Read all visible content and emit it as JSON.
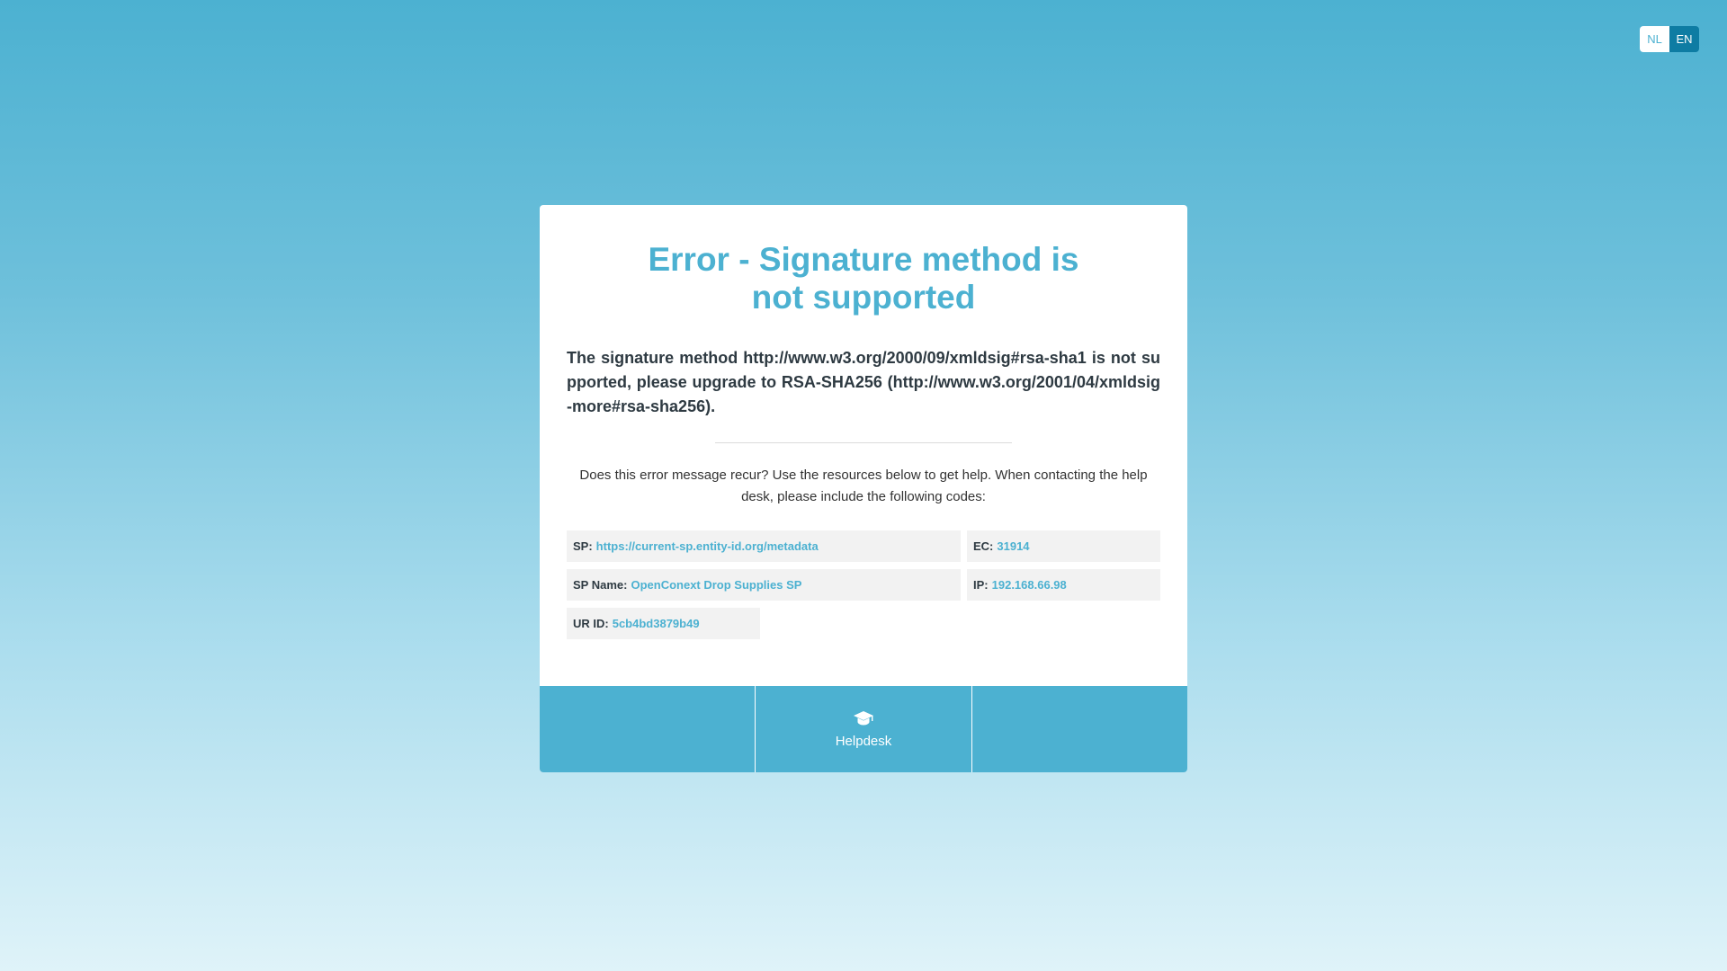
{
  "language_switch": {
    "nl": "NL",
    "en": "EN",
    "active": "EN"
  },
  "error": {
    "title": "Error - Signature method is not supported",
    "message": "The signature method http://www.w3.org/2000/09/xmldsig#rsa-sha1 is not supported, please upgrade to RSA-SHA256 (http://www.w3.org/2001/04/xmldsig-more#rsa-sha256).",
    "help_text": "Does this error message recur? Use the resources below to get help. When contacting the help desk, please include the following codes:"
  },
  "codes": {
    "sp": {
      "label": "SP:",
      "value": "https://current-sp.entity-id.org/metadata"
    },
    "ec": {
      "label": "EC:",
      "value": "31914"
    },
    "sp_name": {
      "label": "SP Name:",
      "value": "OpenConext Drop Supplies SP"
    },
    "ip": {
      "label": "IP:",
      "value": "192.168.66.98"
    },
    "ur_id": {
      "label": "UR ID:",
      "value": "5cb4bd3879b49"
    }
  },
  "footer": {
    "helpdesk_label": "Helpdesk",
    "helpdesk_icon": "graduation-cap-icon"
  },
  "colors": {
    "accent": "#4cb1d1",
    "active_lang": "#0e7ca3",
    "text_dark": "#2e3a42"
  }
}
